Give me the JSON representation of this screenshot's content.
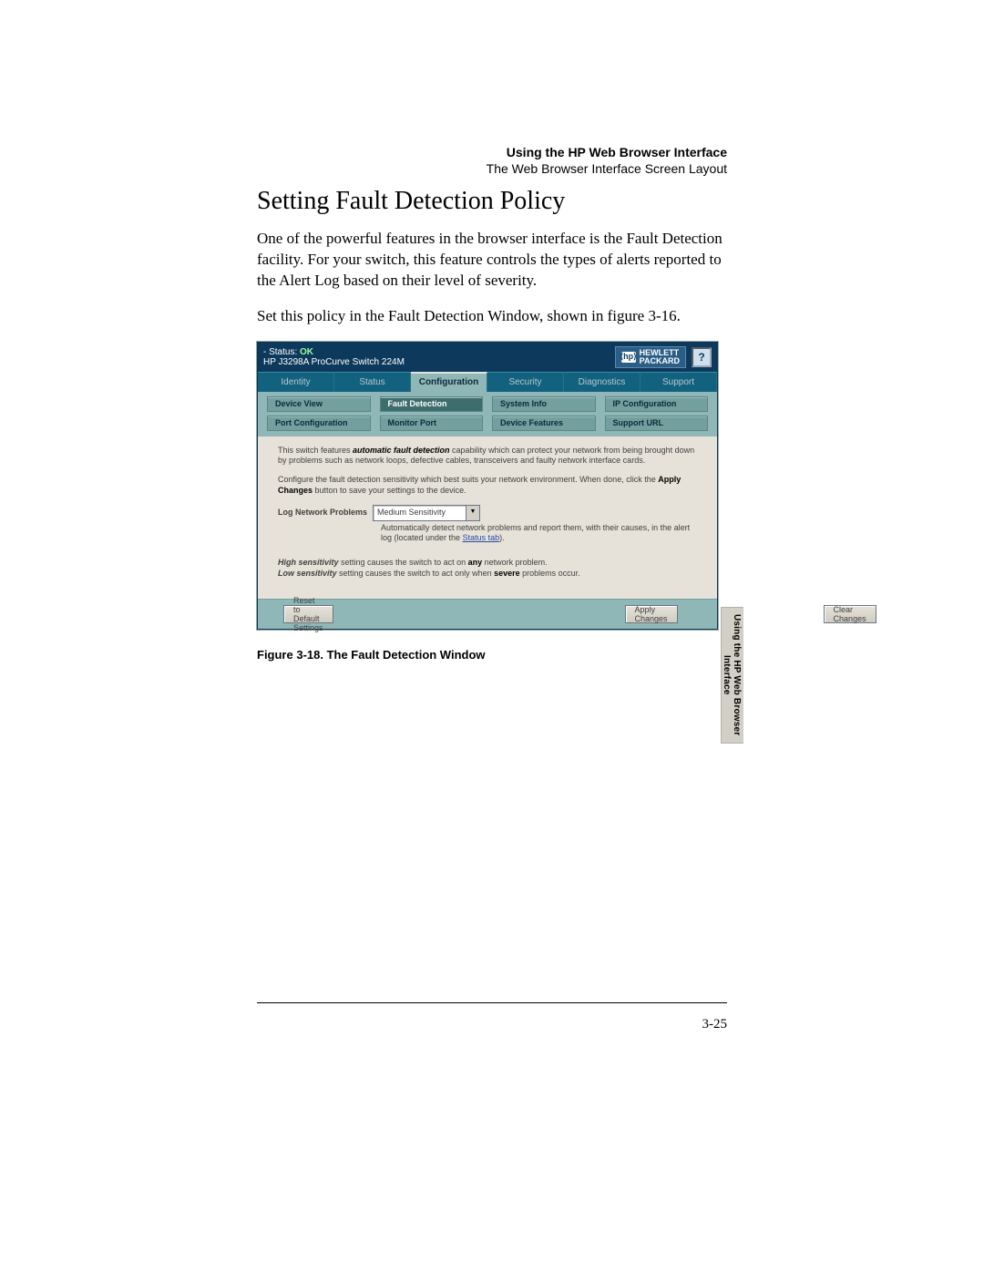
{
  "running_head": {
    "line1": "Using the HP Web Browser Interface",
    "line2": "The Web Browser Interface Screen Layout"
  },
  "section_title": "Setting Fault Detection Policy",
  "para1": "One of the powerful features in the browser interface is the Fault Detection facility. For your switch, this feature controls the types of alerts reported to the Alert Log based on their level of severity.",
  "para2": "Set this policy in the Fault Detection Window, shown in figure 3-16.",
  "window": {
    "status_label": "- Status:",
    "status_value": "OK",
    "device": "HP J3298A ProCurve Switch 224M",
    "logo_mark": "⟨hp⟩",
    "logo_text1": "HEWLETT",
    "logo_text2": "PACKARD",
    "help_glyph": "?",
    "tabs": [
      "Identity",
      "Status",
      "Configuration",
      "Security",
      "Diagnostics",
      "Support"
    ],
    "tabs_active_index": 2,
    "subtabs_row1": [
      "Device View",
      "Fault Detection",
      "System Info",
      "IP Configuration"
    ],
    "subtabs_row2": [
      "Port Configuration",
      "Monitor Port",
      "Device Features",
      "Support URL"
    ],
    "subtabs_active": "Fault Detection",
    "intro1_a": "This switch features ",
    "intro1_bold": "automatic fault detection",
    "intro1_b": " capability which can protect your network from being brought down by problems such as network loops, defective cables, transceivers and faulty network interface cards.",
    "intro2_a": "Configure the fault detection sensitivity which best suits your network environment. When done, click the ",
    "intro2_bold": "Apply Changes",
    "intro2_b": " button to save your settings to the device.",
    "form_label": "Log Network Problems",
    "form_value": "Medium Sensitivity",
    "helper_a": "Automatically detect network problems and report them, with their causes, in the alert log (located under the ",
    "helper_link": "Status tab",
    "helper_b": ").",
    "sens_hi_i": "High sensitivity",
    "sens_hi_rest_a": " setting causes the switch to act on ",
    "sens_hi_bold": "any",
    "sens_hi_rest_b": " network problem.",
    "sens_lo_i": "Low sensitivity",
    "sens_lo_rest_a": " setting causes the switch to act only when ",
    "sens_lo_bold": "severe",
    "sens_lo_rest_b": " problems occur.",
    "buttons": {
      "reset": "Reset to Default Settings",
      "apply": "Apply Changes",
      "clear": "Clear Changes"
    }
  },
  "figure_caption": "Figure 3-18.  The Fault Detection Window",
  "side_tab_line1": "Using the HP Web Browser",
  "side_tab_line2": "Interface",
  "page_number": "3-25"
}
